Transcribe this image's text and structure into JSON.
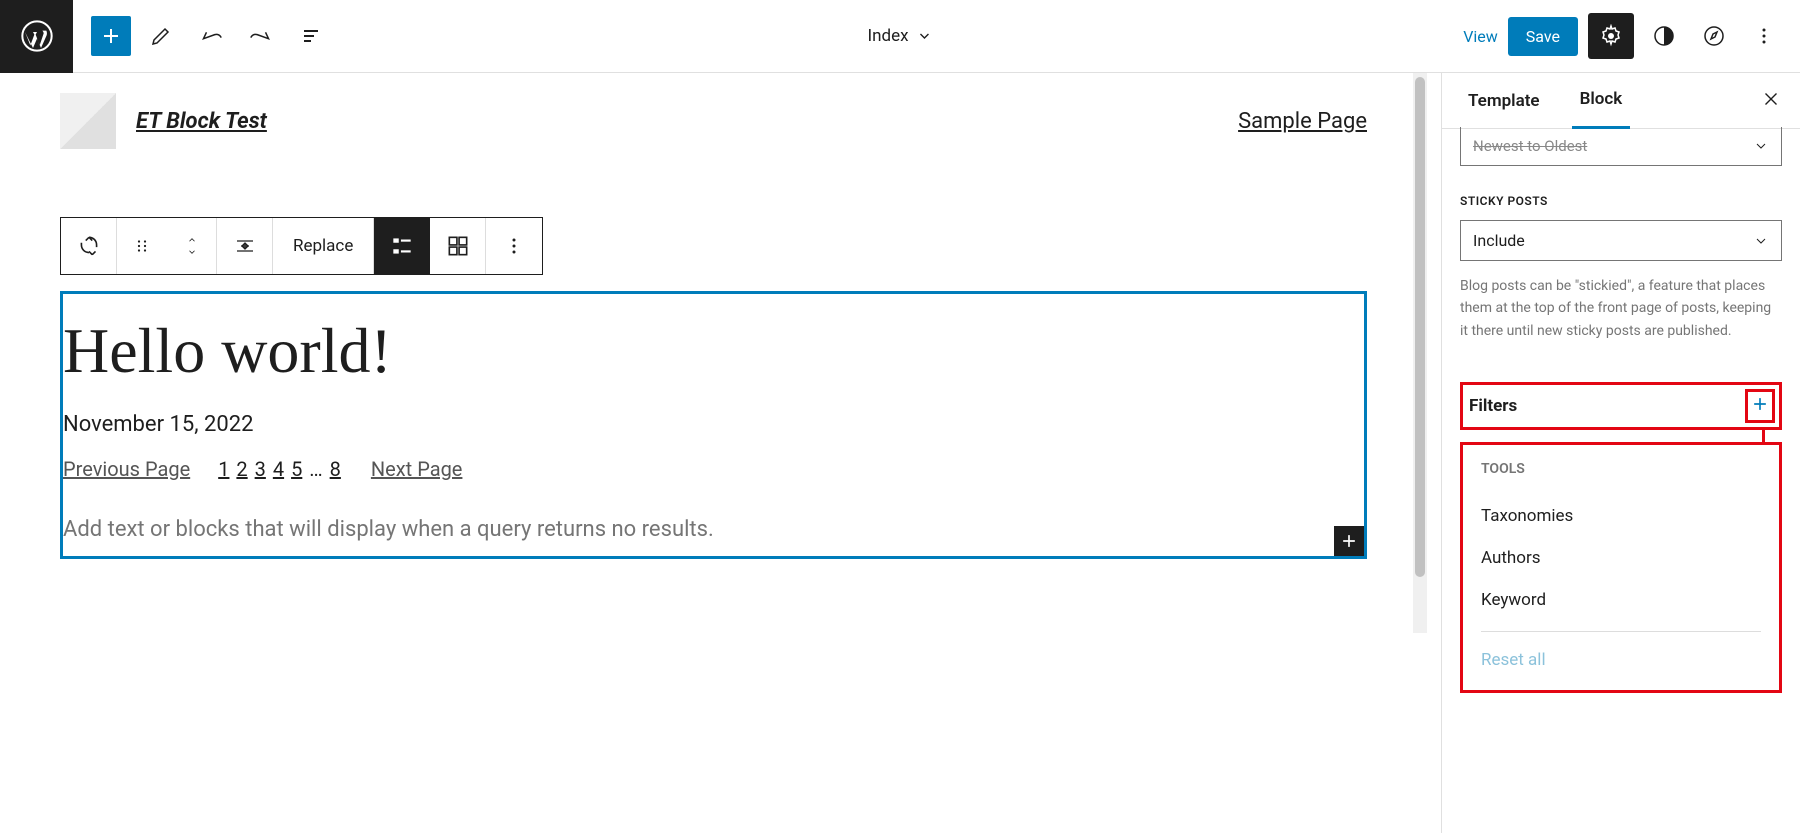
{
  "topbar": {
    "title": "Index",
    "view": "View",
    "save": "Save"
  },
  "header": {
    "site_title": "ET Block Test",
    "nav_link": "Sample Page"
  },
  "toolbar": {
    "replace": "Replace"
  },
  "post": {
    "title": "Hello world!",
    "date": "November 15, 2022",
    "prev": "Previous Page",
    "next": "Next Page",
    "pages": [
      "1",
      "2",
      "3",
      "4",
      "5",
      "…",
      "8"
    ],
    "no_results": "Add text or blocks that will display when a query returns no results."
  },
  "sidebar": {
    "tabs": {
      "template": "Template",
      "block": "Block"
    },
    "order_cut": "Newest to Oldest",
    "sticky_label": "STICKY POSTS",
    "sticky_value": "Include",
    "sticky_help": "Blog posts can be \"stickied\", a feature that places them at the top of the front page of posts, keeping it there until new sticky posts are published.",
    "filters": "Filters",
    "tools_label": "TOOLS",
    "tools": [
      "Taxonomies",
      "Authors",
      "Keyword"
    ],
    "reset": "Reset all"
  }
}
